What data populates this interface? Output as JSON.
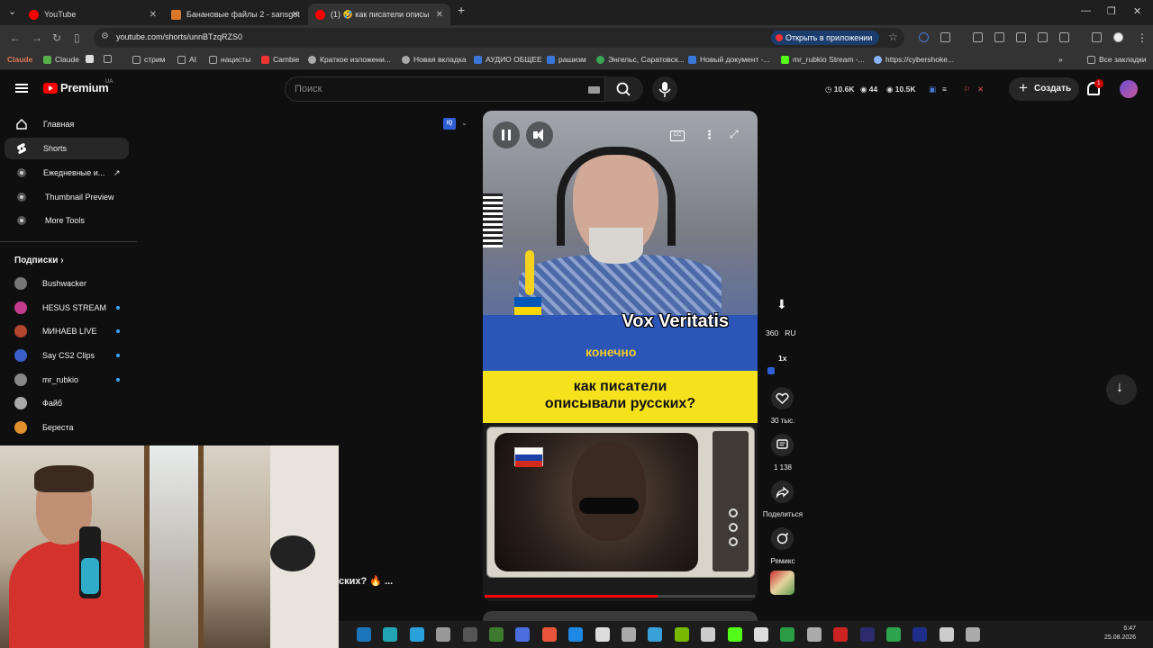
{
  "browser": {
    "tabs": [
      {
        "title": "YouTube",
        "color": "#ff0000"
      },
      {
        "title": "Банановые файлы 2 - sansgot",
        "color": "#d9772a"
      },
      {
        "title": "(1) 🤣 как писатели описы",
        "color": "#ff0000"
      }
    ],
    "url": "youtube.com/shorts/unnBTzqRZS0",
    "open_in_app": "Открыть в приложении",
    "bookmarks": [
      {
        "label": "Claude",
        "color": "#d97757"
      },
      {
        "label": "Claude",
        "color": "#56b14d"
      },
      {
        "label": "",
        "color": "#ddd"
      },
      {
        "label": "",
        "color": "#888"
      },
      {
        "label": "стрим",
        "color": "#999"
      },
      {
        "label": "AI",
        "color": "#999"
      },
      {
        "label": "нацисты",
        "color": "#999"
      },
      {
        "label": "Cambie",
        "color": "#e33"
      },
      {
        "label": "Краткое изложени...",
        "color": "#aaa"
      },
      {
        "label": "Новая вкладка",
        "color": "#aaa"
      },
      {
        "label": "АУДИО ОБЩЕЕ",
        "color": "#3a76d8"
      },
      {
        "label": "рашизм",
        "color": "#3a76d8"
      },
      {
        "label": "Энгельс, Саратовск...",
        "color": "#3aa655"
      },
      {
        "label": "Новый документ -...",
        "color": "#3a76d8"
      },
      {
        "label": "mr_rubkio Stream -...",
        "color": "#53fc18"
      },
      {
        "label": "https://cybershoke...",
        "color": "#8ab4f8"
      }
    ],
    "all_bookmarks": "Все закладки"
  },
  "header": {
    "brand": "Premium",
    "region": "UA",
    "search_placeholder": "Поиск",
    "stats": {
      "views": "10.6K",
      "watching": "44",
      "subs": "10.5K"
    },
    "create_label": "Создать",
    "notif_count": "1"
  },
  "sidebar": {
    "items": [
      {
        "label": "Главная",
        "icon": "home-icon"
      },
      {
        "label": "Shorts",
        "icon": "shorts-icon"
      },
      {
        "label": "Ежедневные и...",
        "icon": "ext-icon"
      },
      {
        "label": "Thumbnail Preview",
        "icon": "ext-icon"
      },
      {
        "label": "More Tools",
        "icon": "ext-icon"
      }
    ],
    "subs_header": "Подписки",
    "subscriptions": [
      {
        "name": "Bushwacker",
        "color": "#777",
        "live": false
      },
      {
        "name": "HESUS STREAM",
        "color": "#c33c8c",
        "live": true
      },
      {
        "name": "МИНАЕВ LIVE",
        "color": "#b2442e",
        "live": true
      },
      {
        "name": "Say CS2 Clips",
        "color": "#3a5fc8",
        "live": true
      },
      {
        "name": "mr_rubkio",
        "color": "#888",
        "live": true
      },
      {
        "name": "Файб",
        "color": "#a9a9a9",
        "live": false
      },
      {
        "name": "Береста",
        "color": "#e0902c",
        "live": false
      }
    ]
  },
  "short": {
    "title_overlay": "Vox Veritatis",
    "subtitle": "конечно",
    "question_line1": "как писатели",
    "question_line2": "описывали русских?",
    "cc_label": "CC",
    "progress": 0.64,
    "caption_fragment": "ских? 🔥 ..."
  },
  "actions": {
    "quality": "360",
    "lang": "RU",
    "speed": "1x",
    "likes": "30 тыс.",
    "comments": "1 138",
    "share": "Поделиться",
    "remix": "Ремикс"
  },
  "taskbar": {
    "time": "6:47",
    "date": "25.08.2026",
    "apps": [
      "#1b75bb",
      "#22a6b3",
      "#2aa1da",
      "#999",
      "#555",
      "#3d7a2e",
      "#4a6ee0",
      "#e8553a",
      "#1e88e5",
      "#ddd",
      "#aaa",
      "#3aa0d8",
      "#76b900",
      "#ccc",
      "#53fc18",
      "#ddd",
      "#2a9d45",
      "#aaa",
      "#cc2222",
      "#2b2b6e",
      "#2da44e",
      "#1f2e8a",
      "#ccc",
      "#aaa"
    ]
  }
}
